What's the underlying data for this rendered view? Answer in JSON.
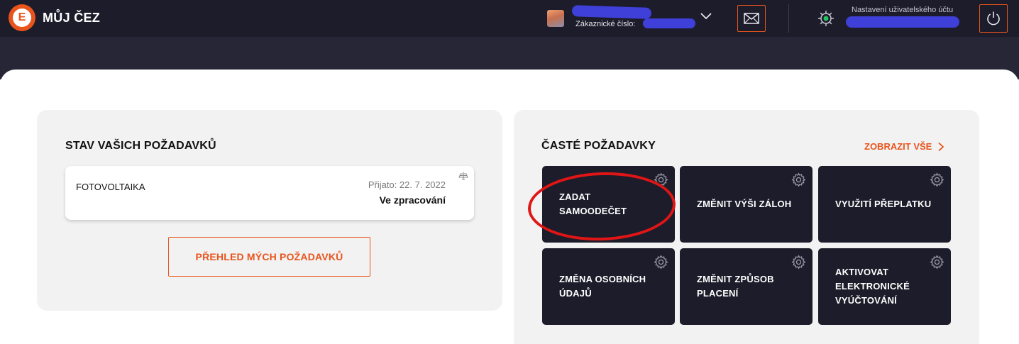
{
  "header": {
    "brand": "MŮJ ČEZ",
    "logo_letter": "E",
    "customer_label": "Zákaznické číslo:",
    "settings_label": "Nastavení uživatelského účtu",
    "icons": {
      "logo": "cez-logo-icon",
      "avatar": "account-avatar",
      "chevron": "chevron-down-icon",
      "mail": "mail-icon",
      "settings": "gear-icon",
      "logout": "power-icon"
    },
    "colors": {
      "bar": "#1c1c2b",
      "accent": "#e8541c",
      "status_dot": "#22c55e",
      "redaction": "#3f3fd9"
    }
  },
  "requests_status": {
    "title": "STAV VAŠICH POŽADAVKŮ",
    "items": [
      {
        "name": "FOTOVOLTAIKA",
        "received": "Přijato: 22. 7. 2022",
        "status": "Ve zpracování"
      }
    ],
    "overview_button": "PŘEHLED MÝCH POŽADAVKŮ"
  },
  "frequent_requests": {
    "title": "ČASTÉ POŽADAVKY",
    "show_all": "ZOBRAZIT VŠE",
    "tiles": [
      {
        "label": "ZADAT\nSAMOODEČET",
        "highlighted": true
      },
      {
        "label": "ZMĚNIT VÝŠI ZÁLOH"
      },
      {
        "label": "VYUŽITÍ PŘEPLATKU"
      },
      {
        "label": "ZMĚNA OSOBNÍCH\nÚDAJŮ"
      },
      {
        "label": "ZMĚNIT ZPŮSOB\nPLACENÍ"
      },
      {
        "label": "AKTIVOVAT\nELEKTRONICKÉ\nVYÚČTOVÁNÍ"
      }
    ],
    "highlight_color": "#e01515"
  }
}
